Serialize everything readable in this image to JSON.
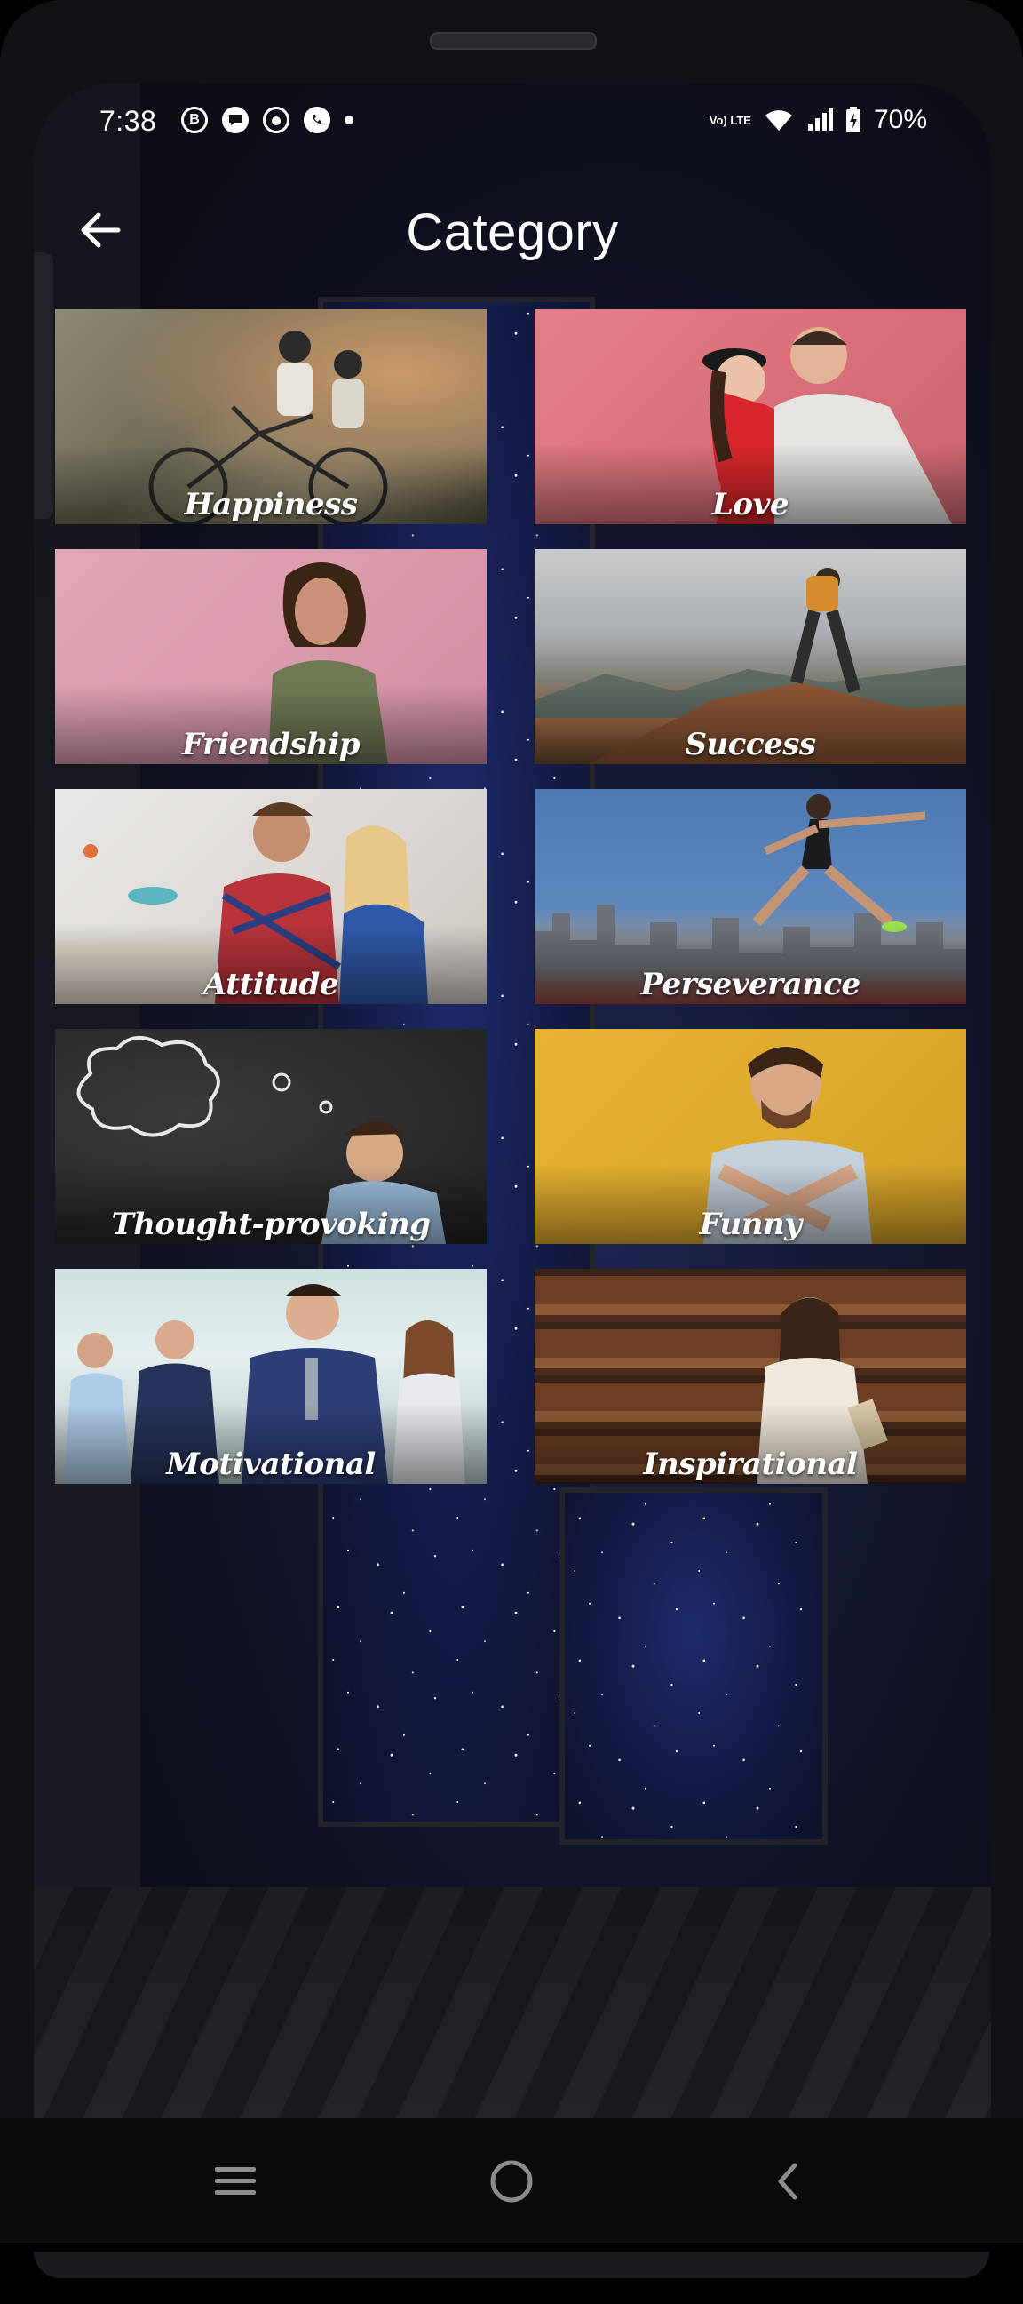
{
  "status_bar": {
    "time": "7:38",
    "network_label": "Vo) LTE",
    "battery_percent": "70%",
    "battery_level": 0.7,
    "notification_icons": [
      "b-icon",
      "chat-bubble-icon",
      "face-icon",
      "phone-icon"
    ]
  },
  "app_bar": {
    "title": "Category",
    "back_icon": "arrow-left-icon"
  },
  "categories": [
    {
      "label": "Happiness"
    },
    {
      "label": "Love"
    },
    {
      "label": "Friendship"
    },
    {
      "label": "Success"
    },
    {
      "label": "Attitude"
    },
    {
      "label": "Perseverance"
    },
    {
      "label": "Thought-provoking"
    },
    {
      "label": "Funny"
    },
    {
      "label": "Motivational"
    },
    {
      "label": "Inspirational"
    }
  ],
  "nav_bar": {
    "recents_icon": "recents-icon",
    "home_icon": "home-icon",
    "back_icon": "back-chevron-icon"
  },
  "colors": {
    "background": "#121216",
    "text": "#ffffff"
  }
}
